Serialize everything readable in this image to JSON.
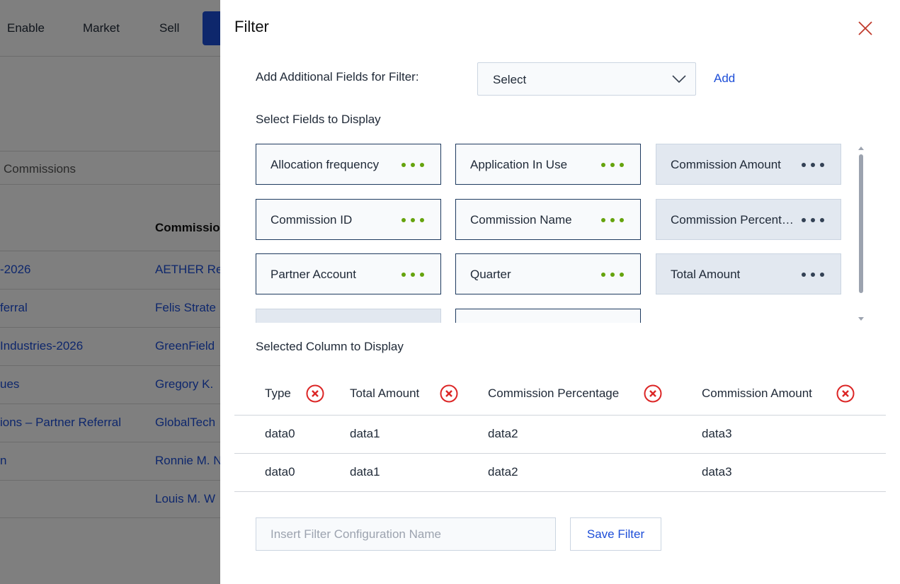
{
  "background": {
    "nav": [
      "Enable",
      "Market",
      "Sell"
    ],
    "tab_label": "Commissions",
    "column_header": "Commissio",
    "rows": [
      {
        "c1": "-2026",
        "c2": "AETHER Re"
      },
      {
        "c1": "ferral",
        "c2": "Felis Strate"
      },
      {
        "c1": "Industries-2026",
        "c2": "GreenField"
      },
      {
        "c1": "ues",
        "c2": "Gregory K."
      },
      {
        "c1": "ions – Partner Referral",
        "c2": "GlobalTech"
      },
      {
        "c1": "n",
        "c2": "Ronnie M. N"
      },
      {
        "c1": "",
        "c2": "Louis M. W"
      }
    ]
  },
  "drawer": {
    "title": "Filter",
    "add_fields_label": "Add Additional Fields for Filter:",
    "select_value": "Select",
    "add_label": "Add",
    "fields_section_label": "Select Fields to Display",
    "fields": [
      {
        "label": "Allocation frequency",
        "state": "available"
      },
      {
        "label": "Application In Use",
        "state": "available"
      },
      {
        "label": "Commission Amount",
        "state": "selected"
      },
      {
        "label": "Commission ID",
        "state": "available"
      },
      {
        "label": "Commission Name",
        "state": "available"
      },
      {
        "label": "Commission Percentage",
        "state": "selected"
      },
      {
        "label": "Partner Account",
        "state": "available"
      },
      {
        "label": "Quarter",
        "state": "available"
      },
      {
        "label": "Total Amount",
        "state": "selected"
      },
      {
        "label": "",
        "state": "selected"
      },
      {
        "label": "",
        "state": "available"
      }
    ],
    "selected_section_label": "Selected Column to Display",
    "columns": [
      "Type",
      "Total Amount",
      "Commission Percentage",
      "Commission Amount"
    ],
    "rows": [
      [
        "data0",
        "data1",
        "data2",
        "data3"
      ],
      [
        "data0",
        "data1",
        "data2",
        "data3"
      ]
    ],
    "filter_name_placeholder": "Insert Filter Configuration Name",
    "filter_name_value": "",
    "save_label": "Save Filter"
  },
  "colors": {
    "accent_blue": "#1d4ed8",
    "dots_green": "#65a30d",
    "dots_dark": "#334155",
    "remove_red": "#dc2626",
    "close_red": "#c0392b"
  }
}
